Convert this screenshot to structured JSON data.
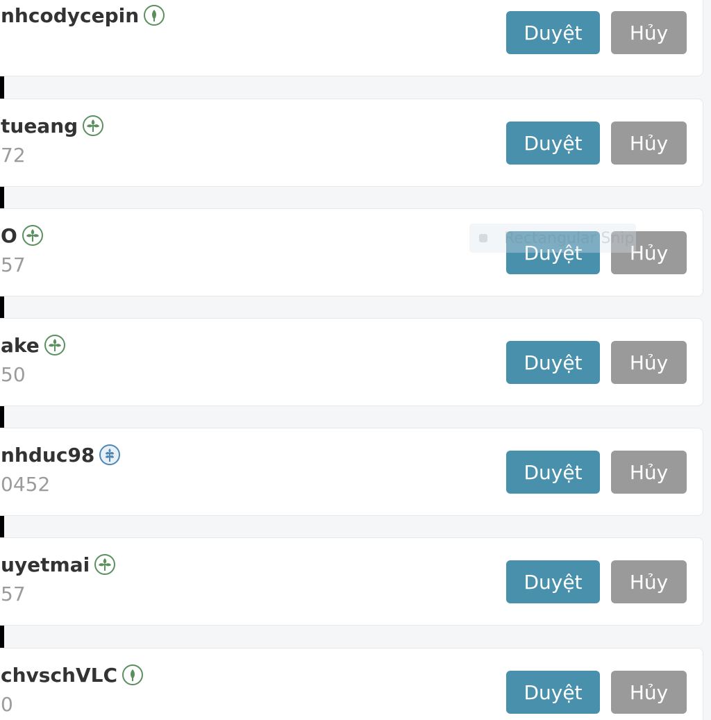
{
  "requests": [
    {
      "name": "nhcodycepin",
      "sub": "",
      "rank_icon": "sprout-icon",
      "approve_label": "Duyệt",
      "cancel_label": "Hủy"
    },
    {
      "name": "tueang",
      "sub": "72",
      "rank_icon": "plant-icon",
      "approve_label": "Duyệt",
      "cancel_label": "Hủy"
    },
    {
      "name": "O",
      "sub": "57",
      "rank_icon": "plant-icon",
      "approve_label": "Duyệt",
      "cancel_label": "Hủy"
    },
    {
      "name": "ake",
      "sub": "50",
      "rank_icon": "plant-icon",
      "approve_label": "Duyệt",
      "cancel_label": "Hủy"
    },
    {
      "name": "nhduc98",
      "sub": "0452",
      "rank_icon": "wheat-icon",
      "approve_label": "Duyệt",
      "cancel_label": "Hủy"
    },
    {
      "name": "uyetmai",
      "sub": "57",
      "rank_icon": "plant-icon",
      "approve_label": "Duyệt",
      "cancel_label": "Hủy"
    },
    {
      "name": "chvschVLC",
      "sub": "0",
      "rank_icon": "sprout-icon",
      "approve_label": "Duyệt",
      "cancel_label": "Hủy"
    }
  ],
  "overlay": {
    "text": "Rectangular Snip"
  },
  "colors": {
    "approve": "#4990ac",
    "cancel": "#9a9a9a",
    "rank_green": "#5a8f5e",
    "rank_blue": "#4f86b3"
  }
}
